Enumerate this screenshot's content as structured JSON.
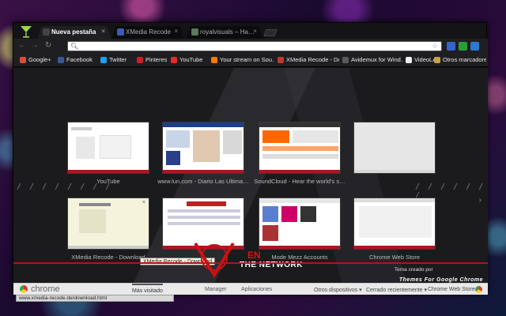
{
  "tabs": [
    {
      "label": "Nueva pestaña",
      "active": true
    },
    {
      "label": "XMedia Recode",
      "active": false
    },
    {
      "label": "royalvisuals – Ha…",
      "active": false
    }
  ],
  "toolbar": {
    "back_icon": "back-arrow-icon",
    "forward_icon": "forward-arrow-icon",
    "reload_icon": "reload-icon",
    "omnibox_value": "",
    "ext_colors": [
      "#3366cc",
      "#2a9d3a",
      "#2e77d0"
    ]
  },
  "bookmarks": [
    {
      "label": "Google+",
      "color": "#dd4b39"
    },
    {
      "label": "Facebook",
      "color": "#3b5998"
    },
    {
      "label": "Twitter",
      "color": "#1da1f2"
    },
    {
      "label": "Pinterest",
      "color": "#cb2027"
    },
    {
      "label": "YouTube",
      "color": "#e52d27"
    },
    {
      "label": "Your stream on Sou…",
      "color": "#ff7700"
    },
    {
      "label": "XMedia Recode - Do…",
      "color": "#c0392b"
    },
    {
      "label": "Avidemux for Wind…",
      "color": "#5a5a5a"
    },
    {
      "label": "VideoLAN, VLC med…",
      "color": "#eeeeee"
    },
    {
      "label": "Otros marcadores",
      "color": "#c8a24a"
    }
  ],
  "thumbnails": [
    {
      "label": "YouTube"
    },
    {
      "label": "www.lun.com - Diario Las Ultima…"
    },
    {
      "label": "SoundCloud - Hear the world's s…"
    },
    {
      "label": ""
    },
    {
      "label": "XMedia Recode - Download"
    },
    {
      "label": "XMedia Recode - Download"
    },
    {
      "label": "Mode Mezz Accounts"
    },
    {
      "label": "Chrome Web Store"
    }
  ],
  "tooltip": "XMedia Recode - Download",
  "brand": {
    "top": "EN",
    "bottom": "THE NETWORK"
  },
  "credit": {
    "line1": "Tema creado por",
    "line2": "Themes For Google Chrome"
  },
  "footer": {
    "brand": "chrome",
    "tabs": [
      "Más visitado",
      "Manager",
      "Aplicaciones"
    ],
    "right": [
      "Otros dispositivos ▾",
      "Cerrado recientemente ▾",
      "Chrome Web Store"
    ]
  },
  "status_url": "www.xmedia-recode.de/download.html"
}
